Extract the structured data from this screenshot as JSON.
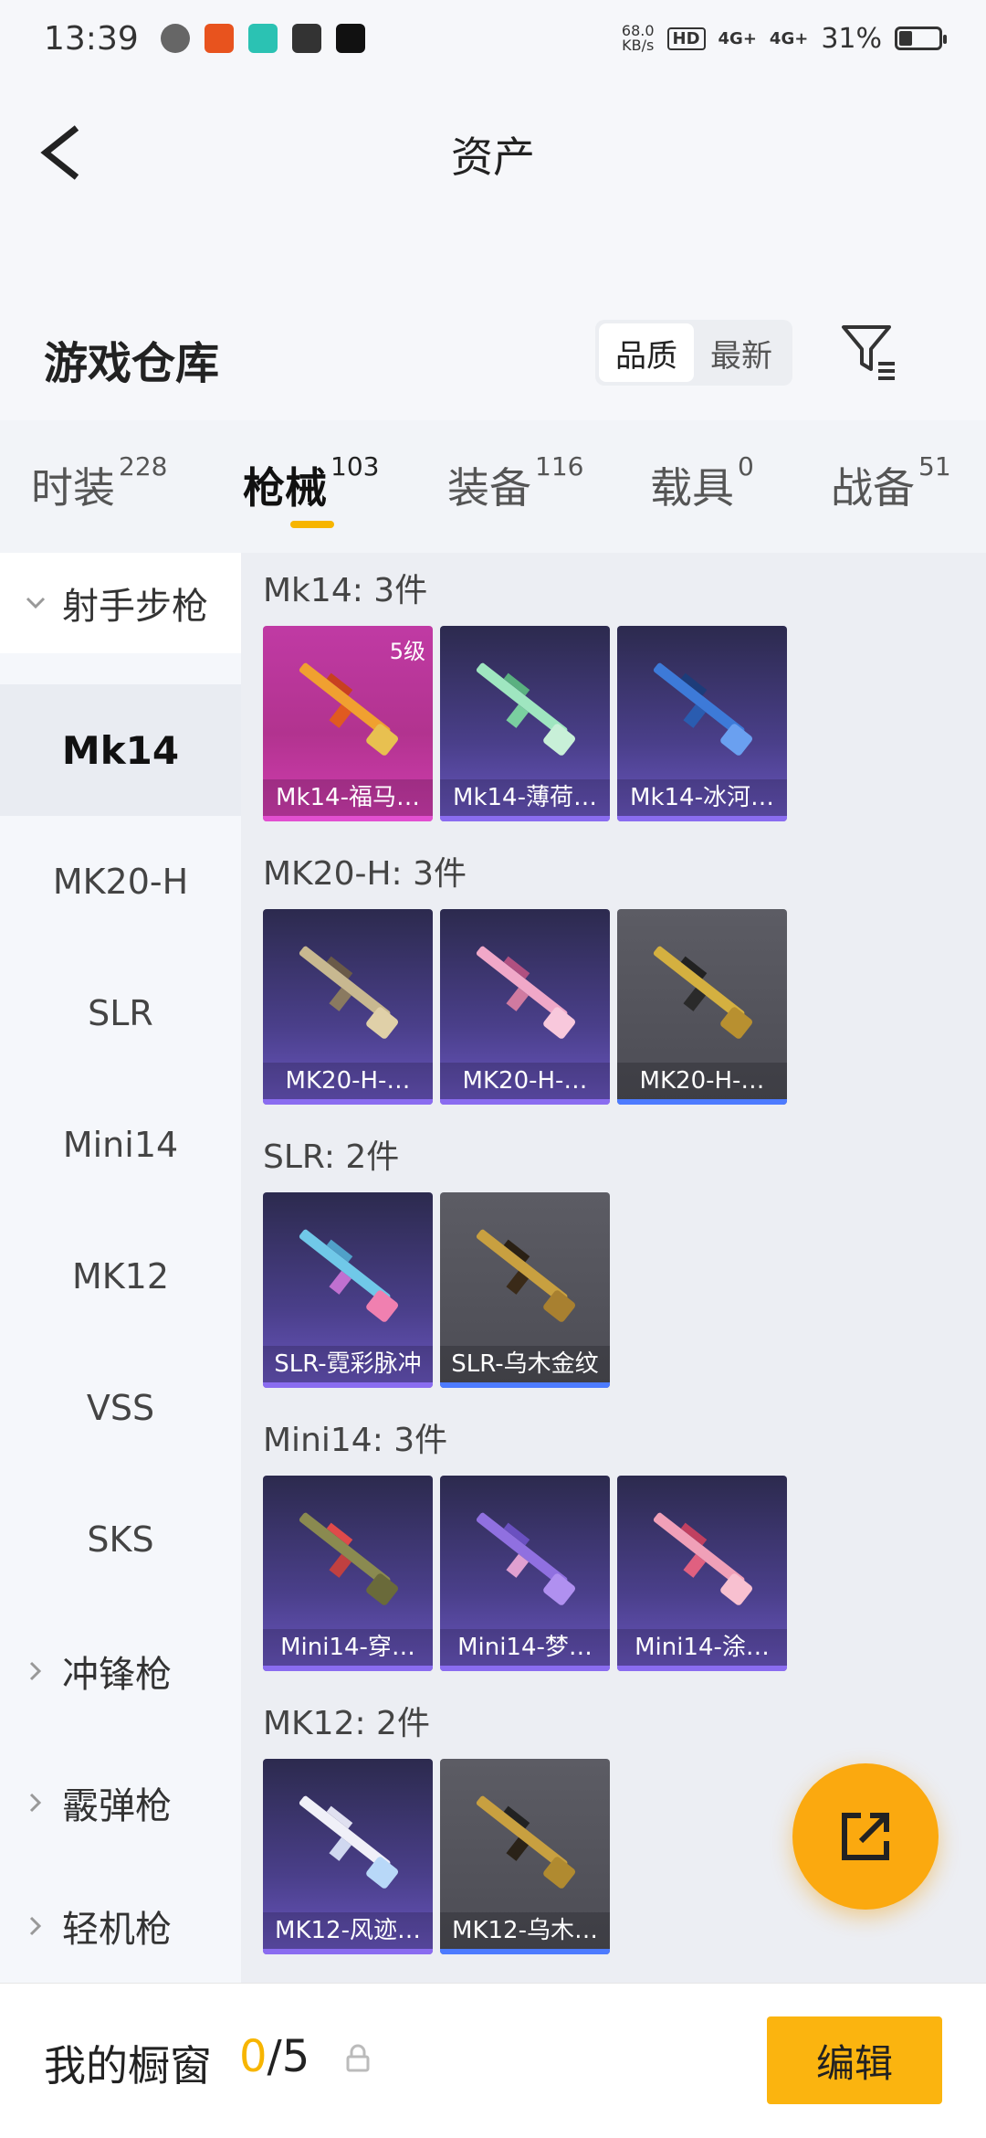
{
  "status_bar": {
    "time": "13:39",
    "net_speed_value": "68.0",
    "net_speed_unit": "KB/s",
    "hd_label": "HD",
    "signal1": "4G+",
    "signal2": "4G+",
    "battery": "31%",
    "battery_level": 0.31
  },
  "header": {
    "title": "资产"
  },
  "section": {
    "title": "游戏仓库",
    "sort_quality": "品质",
    "sort_latest": "最新"
  },
  "tabs": [
    {
      "label": "时装",
      "count": "228"
    },
    {
      "label": "枪械",
      "count": "103"
    },
    {
      "label": "装备",
      "count": "116"
    },
    {
      "label": "载具",
      "count": "0"
    },
    {
      "label": "战备",
      "count": "51"
    }
  ],
  "sidebar": {
    "group_rifle": "射手步枪",
    "items": [
      "Mk14",
      "MK20-H",
      "SLR",
      "Mini14",
      "MK12",
      "VSS",
      "SKS"
    ],
    "group_smg": "冲锋枪",
    "group_shotgun": "霰弹枪",
    "group_lmg": "轻机枪"
  },
  "groups": [
    {
      "label": "Mk14: 3件",
      "cards": [
        {
          "name": "Mk14-福马…",
          "level": "5级"
        },
        {
          "name": "Mk14-薄荷…"
        },
        {
          "name": "Mk14-冰河…"
        }
      ]
    },
    {
      "label": "MK20-H: 3件",
      "cards": [
        {
          "name": "MK20-H-…"
        },
        {
          "name": "MK20-H-…"
        },
        {
          "name": "MK20-H-…"
        }
      ]
    },
    {
      "label": "SLR: 2件",
      "cards": [
        {
          "name": "SLR-霓彩脉冲"
        },
        {
          "name": "SLR-乌木金纹"
        }
      ]
    },
    {
      "label": "Mini14: 3件",
      "cards": [
        {
          "name": "Mini14-穿…"
        },
        {
          "name": "Mini14-梦…"
        },
        {
          "name": "Mini14-涂…"
        }
      ]
    },
    {
      "label": "MK12: 2件",
      "cards": [
        {
          "name": "MK12-风迹…"
        },
        {
          "name": "MK12-乌木…"
        }
      ]
    }
  ],
  "bottom": {
    "showcase_label": "我的橱窗",
    "showcase_current": "0",
    "showcase_total": "/5",
    "edit_label": "编辑"
  },
  "colors": {
    "accent": "#f7b500",
    "fab": "#fba90f",
    "epic": "#6a56c0",
    "legendary": "#c03aa4",
    "grey": "#5c5c64"
  }
}
